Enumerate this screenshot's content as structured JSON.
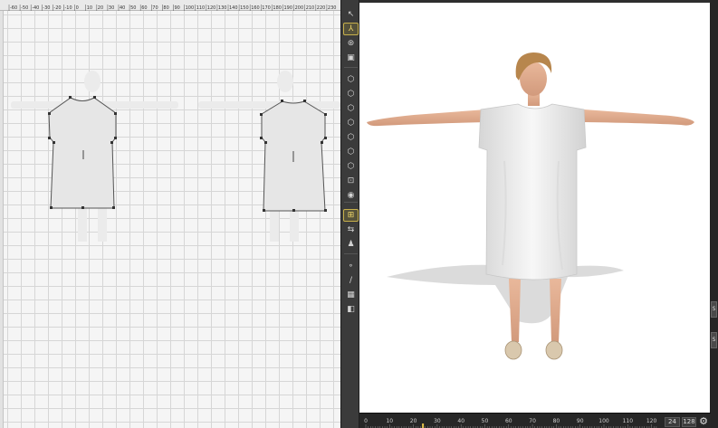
{
  "pattern_window": {
    "ruler_labels": [
      "-60",
      "-50",
      "-40",
      "-30",
      "-20",
      "-10",
      "0",
      "10",
      "20",
      "30",
      "40",
      "50",
      "60",
      "70",
      "80",
      "90",
      "100",
      "110",
      "120",
      "130",
      "140",
      "150",
      "160",
      "170",
      "180",
      "190",
      "200",
      "210",
      "220",
      "230"
    ]
  },
  "toolbar": {
    "buttons": [
      {
        "name": "select-tool",
        "icon": "↖",
        "active": false
      },
      {
        "name": "gizmo-tool",
        "icon": "⅄",
        "active": true
      },
      {
        "name": "rotate-tool",
        "icon": "⊛",
        "active": false
      },
      {
        "name": "layer-tool",
        "icon": "▣",
        "active": false
      },
      {
        "name": "view-cube-1",
        "icon": "⬡",
        "active": false
      },
      {
        "name": "view-cube-2",
        "icon": "⬡",
        "active": false
      },
      {
        "name": "view-cube-3",
        "icon": "⬡",
        "active": false
      },
      {
        "name": "view-cube-4",
        "icon": "⬡",
        "active": false
      },
      {
        "name": "view-cube-5",
        "icon": "⬡",
        "active": false
      },
      {
        "name": "view-cube-6",
        "icon": "⬡",
        "active": false
      },
      {
        "name": "view-cube-7",
        "icon": "⬡",
        "active": false
      },
      {
        "name": "view-fit",
        "icon": "⊡",
        "active": false
      },
      {
        "name": "view-camera",
        "icon": "◉",
        "active": false
      },
      {
        "name": "simulate-tool",
        "icon": "⊞",
        "active": true
      },
      {
        "name": "arrange-tool",
        "icon": "⇆",
        "active": false
      },
      {
        "name": "avatar-tool",
        "icon": "♟",
        "active": false
      },
      {
        "name": "pin-tool",
        "icon": "∘",
        "active": false
      },
      {
        "name": "measure-tool",
        "icon": "∕",
        "active": false
      },
      {
        "name": "texture-tool",
        "icon": "▦",
        "active": false
      },
      {
        "name": "material-tool",
        "icon": "◧",
        "active": false
      }
    ]
  },
  "viewport": {
    "side_tabs": [
      "S",
      "S"
    ]
  },
  "timeline": {
    "tick_labels": [
      "0",
      "10",
      "20",
      "30",
      "40",
      "50",
      "60",
      "70",
      "80",
      "90",
      "100",
      "110",
      "120"
    ],
    "current_frame": "24",
    "end_frame": "128",
    "settings_icon": "gear-icon"
  },
  "colors": {
    "panel_bg": "#3b3b3b",
    "active_border": "#c7b04b",
    "playhead": "#e5c34a",
    "garment_fill": "#e6e6e6"
  }
}
